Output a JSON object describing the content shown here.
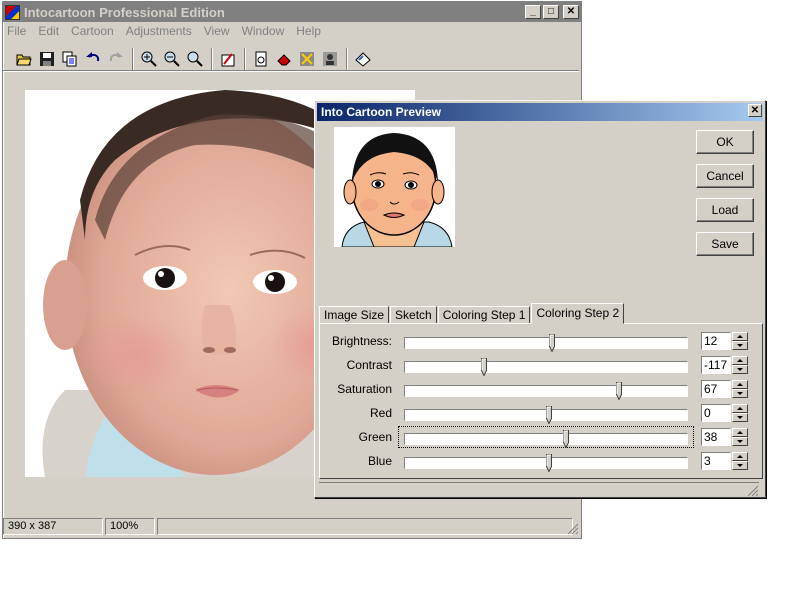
{
  "main_window": {
    "title": "Intocartoon Professional Edition",
    "menu": [
      "File",
      "Edit",
      "Cartoon",
      "Adjustments",
      "View",
      "Window",
      "Help"
    ],
    "toolbar_icons": [
      "open-icon",
      "save-icon",
      "copy-icon",
      "undo-icon",
      "redo-icon",
      "zoom-in-icon",
      "zoom-out-icon",
      "zoom-fit-icon",
      "cartoonize-icon",
      "page-icon",
      "eraser-icon",
      "effect-icon",
      "batch-icon",
      "clear-icon"
    ],
    "status": {
      "dimensions": "390 x 387",
      "zoom": "100%"
    }
  },
  "dialog": {
    "title": "Into Cartoon Preview",
    "buttons": {
      "ok": "OK",
      "cancel": "Cancel",
      "load": "Load",
      "save": "Save"
    },
    "tabs": [
      "Image Size",
      "Sketch",
      "Coloring Step 1",
      "Coloring Step 2"
    ],
    "active_tab": "Coloring Step 2",
    "sliders": [
      {
        "label": "Brightness:",
        "value": "12",
        "position": 0.52
      },
      {
        "label": "Contrast",
        "value": "-117",
        "position": 0.28
      },
      {
        "label": "Saturation",
        "value": "67",
        "position": 0.76
      },
      {
        "label": "Red",
        "value": "0",
        "position": 0.51
      },
      {
        "label": "Green",
        "value": "38",
        "position": 0.57
      },
      {
        "label": "Blue",
        "value": "3",
        "position": 0.51
      }
    ],
    "focused_slider": "Green"
  }
}
